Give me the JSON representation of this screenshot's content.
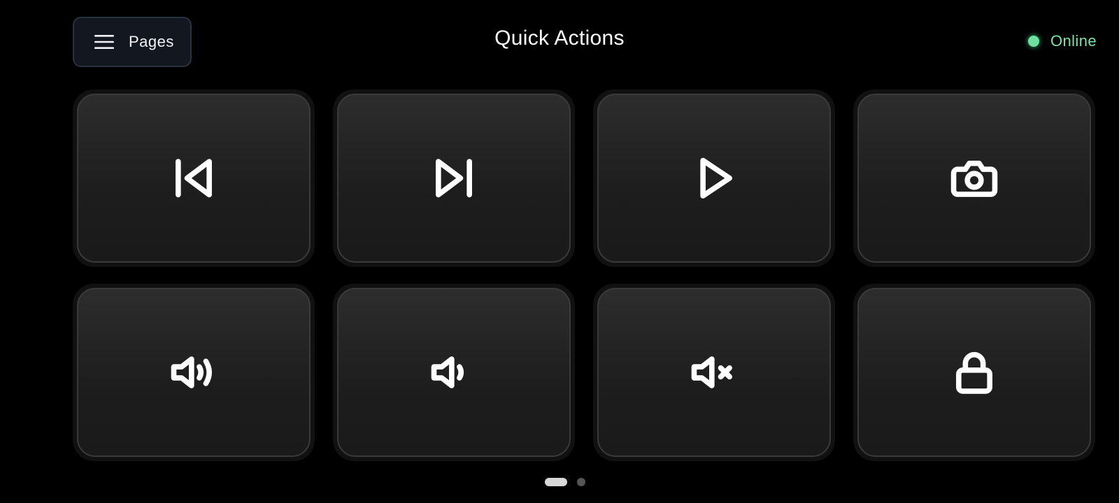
{
  "header": {
    "pages_label": "Pages",
    "title": "Quick Actions",
    "status_label": "Online",
    "status_color": "#6fe0a0"
  },
  "tiles": [
    {
      "icon": "skip-back-icon"
    },
    {
      "icon": "skip-forward-icon"
    },
    {
      "icon": "play-icon"
    },
    {
      "icon": "camera-icon"
    },
    {
      "icon": "volume-up-icon"
    },
    {
      "icon": "volume-down-icon"
    },
    {
      "icon": "volume-mute-icon"
    },
    {
      "icon": "lock-icon"
    }
  ],
  "pager": {
    "pages": 2,
    "current": 1
  }
}
